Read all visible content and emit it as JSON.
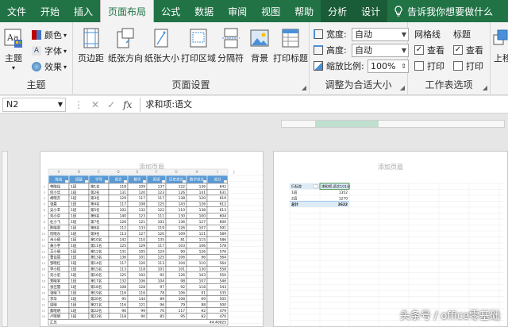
{
  "tabs": [
    "文件",
    "开始",
    "插入",
    "页面布局",
    "公式",
    "数据",
    "审阅",
    "视图",
    "帮助",
    "分析",
    "设计"
  ],
  "active_tab": "页面布局",
  "tell_me": "告诉我你想要做什么",
  "ribbon": {
    "themes": {
      "group": "主题",
      "big": "主题",
      "colors": "颜色",
      "fonts": "字体",
      "effects": "效果"
    },
    "page_setup": {
      "group": "页面设置",
      "margins": "页边距",
      "orientation": "纸张方向",
      "size": "纸张大小",
      "print_area": "打印区域",
      "breaks": "分隔符",
      "background": "背景",
      "print_titles": "打印标题"
    },
    "scale": {
      "group": "调整为合适大小",
      "width_label": "宽度:",
      "width_value": "自动",
      "height_label": "高度:",
      "height_value": "自动",
      "scale_label": "缩放比例:",
      "scale_value": "100%"
    },
    "sheet": {
      "group": "工作表选项",
      "gridlines": "网格线",
      "headings": "标题",
      "view": "查看",
      "print": "打印",
      "gridlines_view_checked": true,
      "headings_view_checked": true
    },
    "arrange": {
      "bring_forward": "上移"
    }
  },
  "formula_bar": {
    "name_box": "N2",
    "formula": "求和项:语文"
  },
  "page1": {
    "header": "添加页眉",
    "col_letters": [
      "A",
      "B",
      "C",
      "D",
      "E",
      "F",
      "G",
      "H",
      "I",
      "J"
    ],
    "headers": [
      "姓名",
      "班级",
      "学号",
      "语文",
      "数学",
      "英语",
      "历史总分",
      "数学总分",
      "总分"
    ],
    "rows": [
      [
        "林晓佳",
        "1班",
        "第1名",
        "118",
        "109",
        "137",
        "122",
        "136",
        "642"
      ],
      [
        "何小华",
        "1班",
        "第2名",
        "131",
        "120",
        "123",
        "126",
        "141",
        "631"
      ],
      [
        "胡晓芬",
        "1班",
        "第3名",
        "129",
        "117",
        "117",
        "138",
        "120",
        "619"
      ],
      [
        "张晨",
        "1班",
        "第4名",
        "117",
        "108",
        "125",
        "143",
        "126",
        "612"
      ],
      [
        "吴小丰",
        "1班",
        "第5名",
        "102",
        "132",
        "122",
        "110",
        "138",
        "613"
      ],
      [
        "刘小芬",
        "1班",
        "第6名",
        "140",
        "123",
        "111",
        "130",
        "100",
        "604"
      ],
      [
        "杜小飞",
        "1班",
        "第7名",
        "126",
        "121",
        "102",
        "136",
        "127",
        "600"
      ],
      [
        "陈晓君",
        "1班",
        "第8名",
        "112",
        "133",
        "119",
        "126",
        "107",
        "591"
      ],
      [
        "何晓东",
        "1班",
        "第9名",
        "113",
        "127",
        "120",
        "109",
        "121",
        "589"
      ],
      [
        "肖小倩",
        "1班",
        "第10名",
        "142",
        "110",
        "135",
        "81",
        "115",
        "586"
      ],
      [
        "黄小宇",
        "1班",
        "第11名",
        "125",
        "129",
        "117",
        "103",
        "106",
        "578"
      ],
      [
        "王小明",
        "1班",
        "第12名",
        "131",
        "105",
        "124",
        "90",
        "126",
        "576"
      ],
      [
        "曹佳丽",
        "1班",
        "第13名",
        "136",
        "101",
        "125",
        "106",
        "96",
        "564"
      ],
      [
        "邹晓红",
        "1班",
        "第14名",
        "117",
        "120",
        "113",
        "104",
        "110",
        "564"
      ],
      [
        "李小辉",
        "1班",
        "第15名",
        "113",
        "118",
        "101",
        "101",
        "130",
        "558"
      ],
      [
        "刘小宏",
        "1班",
        "第16名",
        "125",
        "102",
        "95",
        "126",
        "103",
        "550"
      ],
      [
        "郑晓宇",
        "1班",
        "第17名",
        "132",
        "106",
        "104",
        "98",
        "107",
        "546"
      ],
      [
        "张佳慧",
        "1班",
        "第18名",
        "108",
        "128",
        "97",
        "92",
        "118",
        "543"
      ],
      [
        "张晓飞",
        "1班",
        "第19名",
        "116",
        "116",
        "78",
        "106",
        "91",
        "535"
      ],
      [
        "李华",
        "1班",
        "第20名",
        "95",
        "144",
        "89",
        "108",
        "69",
        "505"
      ],
      [
        "周晓",
        "1班",
        "第21名",
        "116",
        "121",
        "96",
        "79",
        "88",
        "500"
      ],
      [
        "蔡晓明",
        "1班",
        "第22名",
        "96",
        "99",
        "76",
        "117",
        "92",
        "479"
      ],
      [
        "卢晓明",
        "1班",
        "第23名",
        "118",
        "90",
        "85",
        "95",
        "82",
        "470"
      ]
    ],
    "footer_label": "汇总",
    "footer_value": "44.40025"
  },
  "page2": {
    "header": "添加页眉",
    "pivot_header_label": "行标签",
    "pivot_header_value": "求和项:语文101分",
    "rows": [
      [
        "1班",
        "1352"
      ],
      [
        "2班",
        "1270"
      ],
      [
        "总计",
        "2622"
      ]
    ]
  },
  "watermark": "头条号 / office零基础",
  "colors": {
    "brand": "#217346",
    "header_fill": "#5b9bd5",
    "header_fill_light": "#bdd7ee",
    "pivot_fill": "#ddebf7"
  }
}
